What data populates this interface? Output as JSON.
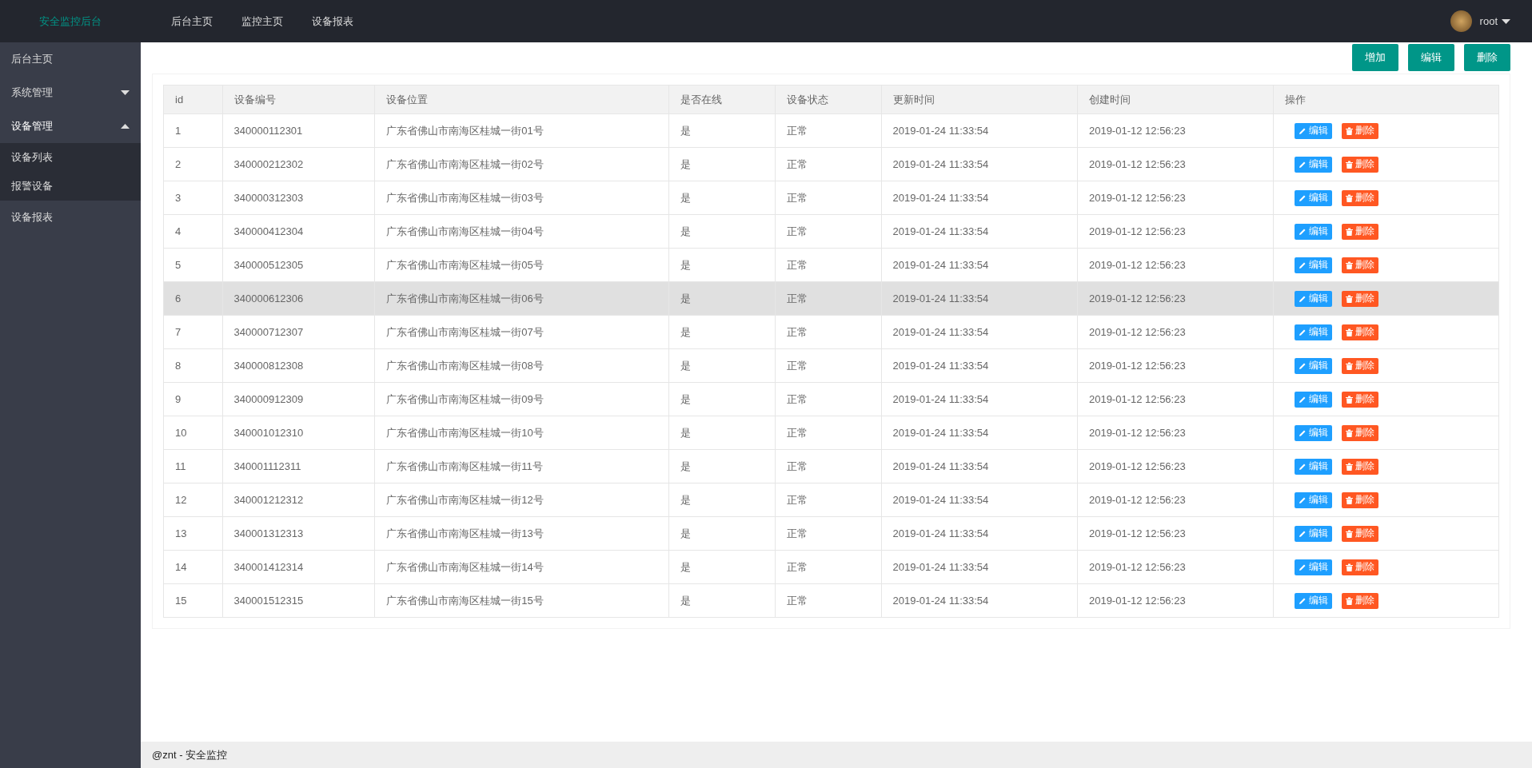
{
  "header": {
    "logo": "安全监控后台",
    "nav": [
      {
        "label": "后台主页"
      },
      {
        "label": "监控主页"
      },
      {
        "label": "设备报表"
      }
    ],
    "user": {
      "name": "root"
    }
  },
  "sidebar": {
    "items": [
      {
        "label": "后台主页",
        "kind": "link"
      },
      {
        "label": "系统管理",
        "kind": "group",
        "expanded": false
      },
      {
        "label": "设备管理",
        "kind": "group",
        "expanded": true,
        "children": [
          {
            "label": "设备列表"
          },
          {
            "label": "报警设备"
          }
        ]
      },
      {
        "label": "设备报表",
        "kind": "link"
      }
    ]
  },
  "toolbar": {
    "buttons": [
      "增加",
      "编辑",
      "删除"
    ]
  },
  "table": {
    "columns": [
      "id",
      "设备编号",
      "设备位置",
      "是否在线",
      "设备状态",
      "更新时间",
      "创建时间",
      "操作"
    ],
    "rows": [
      {
        "cells": [
          "1",
          "340000112301",
          "广东省佛山市南海区桂城一街01号",
          "是",
          "正常",
          "2019-01-24 11:33:54",
          "2019-01-12 12:56:23"
        ],
        "actions": [
          "编辑",
          "删除"
        ],
        "highlighted": false
      },
      {
        "cells": [
          "2",
          "340000212302",
          "广东省佛山市南海区桂城一街02号",
          "是",
          "正常",
          "2019-01-24 11:33:54",
          "2019-01-12 12:56:23"
        ],
        "actions": [
          "编辑",
          "删除"
        ],
        "highlighted": false
      },
      {
        "cells": [
          "3",
          "340000312303",
          "广东省佛山市南海区桂城一街03号",
          "是",
          "正常",
          "2019-01-24 11:33:54",
          "2019-01-12 12:56:23"
        ],
        "actions": [
          "编辑",
          "删除"
        ],
        "highlighted": false
      },
      {
        "cells": [
          "4",
          "340000412304",
          "广东省佛山市南海区桂城一街04号",
          "是",
          "正常",
          "2019-01-24 11:33:54",
          "2019-01-12 12:56:23"
        ],
        "actions": [
          "编辑",
          "删除"
        ],
        "highlighted": false
      },
      {
        "cells": [
          "5",
          "340000512305",
          "广东省佛山市南海区桂城一街05号",
          "是",
          "正常",
          "2019-01-24 11:33:54",
          "2019-01-12 12:56:23"
        ],
        "actions": [
          "编辑",
          "删除"
        ],
        "highlighted": false
      },
      {
        "cells": [
          "6",
          "340000612306",
          "广东省佛山市南海区桂城一街06号",
          "是",
          "正常",
          "2019-01-24 11:33:54",
          "2019-01-12 12:56:23"
        ],
        "actions": [
          "编辑",
          "删除"
        ],
        "highlighted": true
      },
      {
        "cells": [
          "7",
          "340000712307",
          "广东省佛山市南海区桂城一街07号",
          "是",
          "正常",
          "2019-01-24 11:33:54",
          "2019-01-12 12:56:23"
        ],
        "actions": [
          "编辑",
          "删除"
        ],
        "highlighted": false
      },
      {
        "cells": [
          "8",
          "340000812308",
          "广东省佛山市南海区桂城一街08号",
          "是",
          "正常",
          "2019-01-24 11:33:54",
          "2019-01-12 12:56:23"
        ],
        "actions": [
          "编辑",
          "删除"
        ],
        "highlighted": false
      },
      {
        "cells": [
          "9",
          "340000912309",
          "广东省佛山市南海区桂城一街09号",
          "是",
          "正常",
          "2019-01-24 11:33:54",
          "2019-01-12 12:56:23"
        ],
        "actions": [
          "编辑",
          "删除"
        ],
        "highlighted": false
      },
      {
        "cells": [
          "10",
          "340001012310",
          "广东省佛山市南海区桂城一街10号",
          "是",
          "正常",
          "2019-01-24 11:33:54",
          "2019-01-12 12:56:23"
        ],
        "actions": [
          "编辑",
          "删除"
        ],
        "highlighted": false
      },
      {
        "cells": [
          "11",
          "340001112311",
          "广东省佛山市南海区桂城一街11号",
          "是",
          "正常",
          "2019-01-24 11:33:54",
          "2019-01-12 12:56:23"
        ],
        "actions": [
          "编辑",
          "删除"
        ],
        "highlighted": false
      },
      {
        "cells": [
          "12",
          "340001212312",
          "广东省佛山市南海区桂城一街12号",
          "是",
          "正常",
          "2019-01-24 11:33:54",
          "2019-01-12 12:56:23"
        ],
        "actions": [
          "编辑",
          "删除"
        ],
        "highlighted": false
      },
      {
        "cells": [
          "13",
          "340001312313",
          "广东省佛山市南海区桂城一街13号",
          "是",
          "正常",
          "2019-01-24 11:33:54",
          "2019-01-12 12:56:23"
        ],
        "actions": [
          "编辑",
          "删除"
        ],
        "highlighted": false
      },
      {
        "cells": [
          "14",
          "340001412314",
          "广东省佛山市南海区桂城一街14号",
          "是",
          "正常",
          "2019-01-24 11:33:54",
          "2019-01-12 12:56:23"
        ],
        "actions": [
          "编辑",
          "删除"
        ],
        "highlighted": false
      },
      {
        "cells": [
          "15",
          "340001512315",
          "广东省佛山市南海区桂城一街15号",
          "是",
          "正常",
          "2019-01-24 11:33:54",
          "2019-01-12 12:56:23"
        ],
        "actions": [
          "编辑",
          "删除"
        ],
        "highlighted": false
      }
    ]
  },
  "footer": {
    "text": "@znt - 安全监控"
  }
}
